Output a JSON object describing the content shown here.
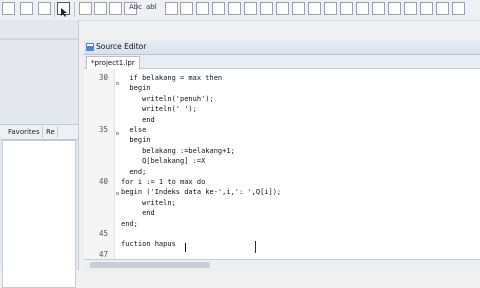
{
  "editor": {
    "title": "Source Editor",
    "file_tab": "*project1.lpr"
  },
  "left_tabs": [
    "Favorites",
    "Re"
  ],
  "toolbar_text": [
    "Abc",
    "abl"
  ],
  "lines": [
    {
      "n": "30",
      "text": "  if belakang = max then"
    },
    {
      "n": "",
      "text": "  begin"
    },
    {
      "n": "",
      "text": "     writeln('penuh');"
    },
    {
      "n": "",
      "text": "     writeln(' ');"
    },
    {
      "n": "",
      "text": "     end"
    },
    {
      "n": "35",
      "text": "  else"
    },
    {
      "n": "",
      "text": "  begin"
    },
    {
      "n": "",
      "text": "     belakang :=belakang+1;"
    },
    {
      "n": "",
      "text": "     Q[belakang] :=X"
    },
    {
      "n": "",
      "text": "  end;"
    },
    {
      "n": "40",
      "text": "for i := 1 to max do"
    },
    {
      "n": "",
      "text": "begin ('Indeks data ke-',i,': ',Q[i]);"
    },
    {
      "n": "",
      "text": "     writeln;"
    },
    {
      "n": "",
      "text": "     end"
    },
    {
      "n": "",
      "text": "end;"
    },
    {
      "n": "45",
      "text": ""
    },
    {
      "n": "",
      "text": "fuction hapus"
    },
    {
      "n": "47",
      "text": ""
    }
  ]
}
